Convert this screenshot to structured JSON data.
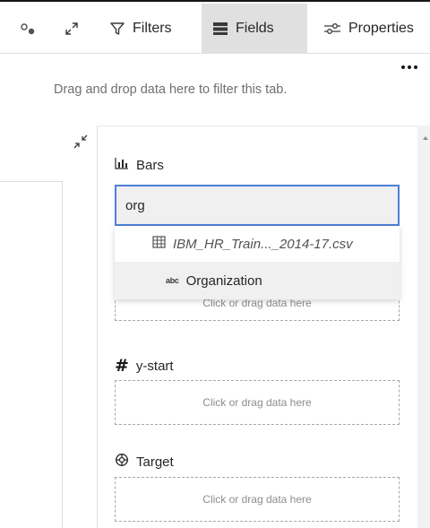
{
  "toolbar": {
    "filters_label": "Filters",
    "fields_label": "Fields",
    "properties_label": "Properties",
    "icons": {
      "key": "key-icon",
      "expand": "expand-icon",
      "filters": "filter-icon",
      "fields": "fields-icon",
      "properties": "sliders-icon",
      "more": "overflow-menu-icon"
    }
  },
  "filter_area": {
    "hint": "Drag and drop data here to filter this tab."
  },
  "fields_panel": {
    "bars": {
      "label": "Bars",
      "icon": "bar-chart-icon"
    },
    "search": {
      "value": "org"
    },
    "dropdown": {
      "source_file": "IBM_HR_Train..._2014-17.csv",
      "source_icon": "table-icon",
      "match_field": "Organization",
      "match_icon": "text-type-icon",
      "match_icon_text": "abc"
    },
    "bars_dropzone": "Click or drag data here",
    "ystart": {
      "label": "y-start",
      "icon_text": "#",
      "dropzone": "Click or drag data here"
    },
    "target": {
      "label": "Target",
      "icon": "target-icon",
      "dropzone": "Click or drag data here"
    }
  },
  "colors": {
    "accent_border": "#4d7fd6",
    "active_tab": "#e0e0e0",
    "muted_text": "#8d8d8d"
  }
}
